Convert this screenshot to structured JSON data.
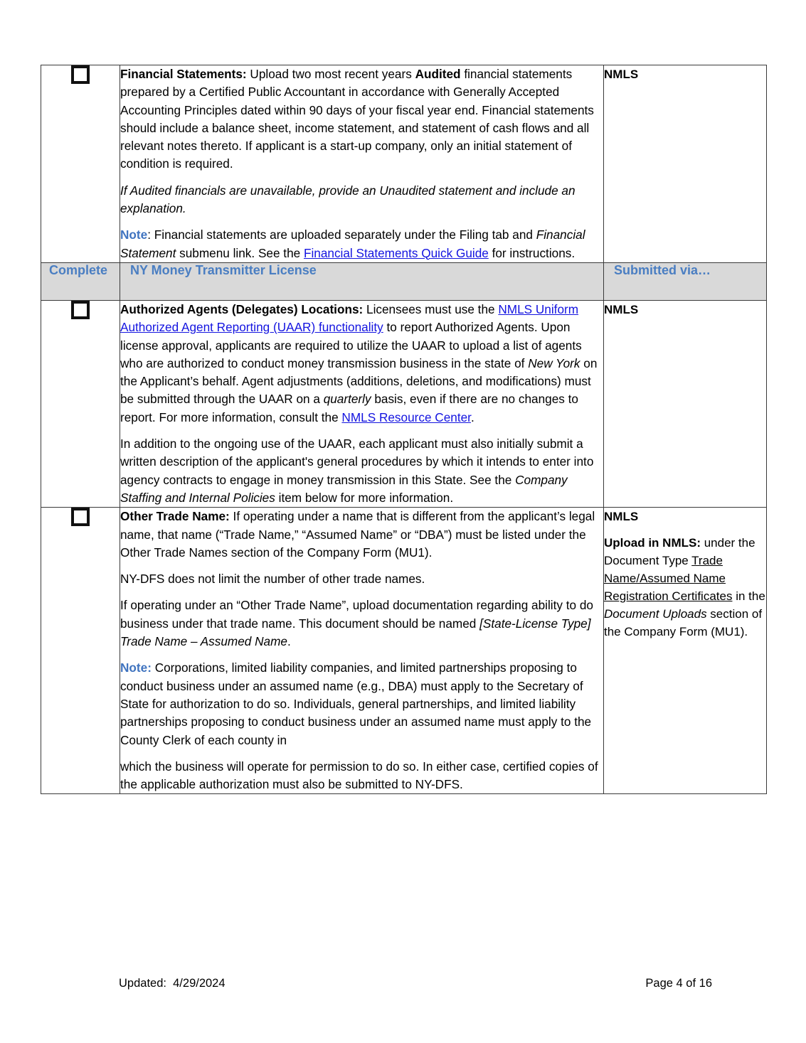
{
  "document": {
    "page_label": "Page 4 of 16",
    "updated_label": "Updated:  4/29/2024"
  },
  "colors": {
    "header_bg": "#d9d9d9",
    "header_text": "#4a7ec2",
    "link": "#1414e0",
    "note_label": "#3f73bf"
  },
  "section_header": {
    "complete": "Complete",
    "title": "NY Money Transmitter License",
    "submitted_via": "Submitted via…"
  },
  "rows": {
    "financial_statements": {
      "via": "NMLS",
      "p1": {
        "lead": "Financial Statements:",
        "t1": " Upload two most recent years ",
        "bold2": "Audited",
        "t2": " financial statements prepared by a Certified Public Accountant in accordance with Generally Accepted Accounting Principles dated within 90 days of your fiscal year end. Financial statements should include a balance sheet, income statement, and statement of cash flows and all relevant notes thereto. If applicant is a start-up company, only an initial statement of condition is required."
      },
      "p2_italic": "If Audited financials are unavailable, provide an Unaudited statement and include an explanation.",
      "p3": {
        "note": "Note",
        "t1": ": Financial statements are uploaded separately under the Filing tab and ",
        "italic": "Financial Statement",
        "t2": " submenu link. See the ",
        "link": "Financial Statements Quick Guide",
        "t3": " for instructions."
      }
    },
    "authorized_agents": {
      "via": "NMLS",
      "p1": {
        "lead": "Authorized Agents (Delegates) Locations:",
        "t1": " Licensees must use the ",
        "link1": "NMLS Uniform Authorized Agent Reporting (UAAR) functionality",
        "t2": " to report Authorized Agents.  Upon license approval, applicants are required to utilize the UAAR to upload a list of agents who are authorized to conduct money transmission business in the state of ",
        "italic1": "New York",
        "t3": " on the Applicant’s behalf.  Agent adjustments (additions, deletions, and modifications) must be submitted through the UAAR on a ",
        "italic2": "quarterly",
        "t4": " basis, even if there are no changes to report.  For more information, consult the ",
        "link2": "NMLS Resource Center",
        "t5": "."
      },
      "p2": {
        "t1": "In addition to the ongoing use of the UAAR, each applicant must also initially submit a written description of the applicant's general procedures by which it intends to enter into agency contracts to engage in money transmission in this State.  See the ",
        "italic": "Company Staffing and Internal Policies",
        "t2": " item below for more information."
      }
    },
    "other_trade_name": {
      "via_line1": "NMLS",
      "via_p2": {
        "lead": "Upload in NMLS:",
        "t1": " under the Document Type ",
        "underline": "Trade Name/Assumed Name Registration Certificates",
        "t2": " in the ",
        "italic": "Document Uploads",
        "t3": " section of the Company Form (MU1)."
      },
      "p1": {
        "lead": "Other Trade Name:",
        "t1": " If operating under a name that is different from the applicant’s legal name, that name (“Trade Name,” “Assumed Name” or “DBA”) must be listed under the Other Trade Names section of the Company Form (MU1)."
      },
      "p2": "NY-DFS does not limit the number of other trade names.",
      "p3": {
        "t1": "If operating under an “Other Trade Name”, upload documentation regarding ability to do business under that trade name. This document should be named ",
        "italic": "[State-License Type] Trade Name – Assumed Name",
        "t2": "."
      },
      "p4": {
        "note": "Note:",
        "t1": " Corporations, limited liability companies, and limited partnerships proposing to conduct business under an assumed name (e.g., DBA) must apply to the Secretary of State for authorization to do so. Individuals, general partnerships, and limited liability partnerships proposing to conduct business under an assumed name must apply to the County Clerk of each county in"
      },
      "p5": "which the business will operate for permission to do so. In either case, certified copies of the applicable authorization must also be submitted to NY-DFS."
    }
  }
}
